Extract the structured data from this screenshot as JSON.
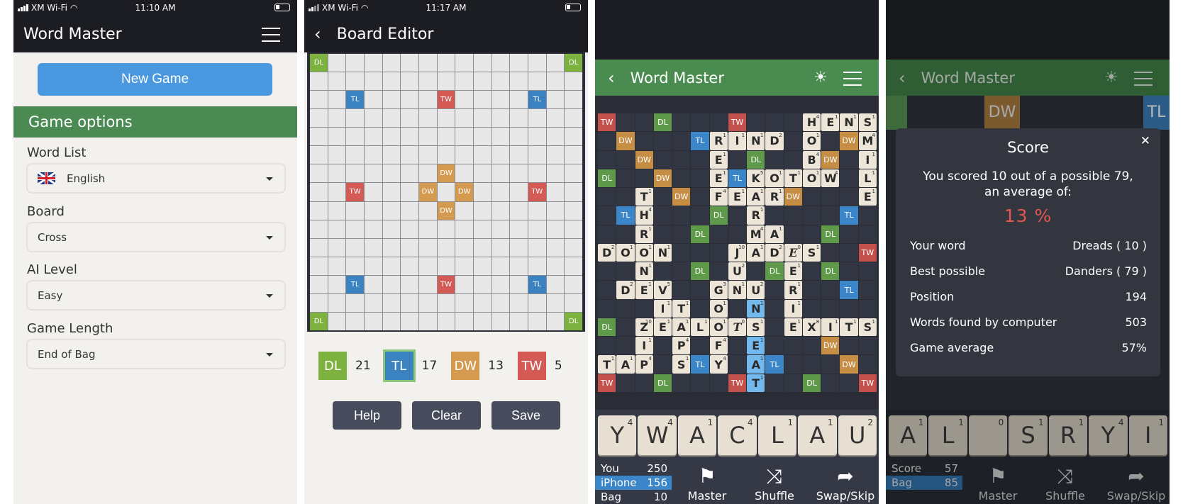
{
  "screen1": {
    "status": {
      "carrier": "XM Wi-Fi",
      "time": "11:10 AM"
    },
    "title": "Word Master",
    "new_game_label": "New Game",
    "options_header": "Game options",
    "options": [
      {
        "label": "Word List",
        "value": "English",
        "flag": "uk-flag"
      },
      {
        "label": "Board",
        "value": "Cross"
      },
      {
        "label": "AI Level",
        "value": "Easy"
      },
      {
        "label": "Game Length",
        "value": "End of Bag"
      }
    ]
  },
  "screen2": {
    "status": {
      "carrier": "XM Wi-Fi",
      "time": "11:17 AM"
    },
    "title": "Board Editor",
    "board": {
      "size": 15,
      "premiums": [
        {
          "r": 0,
          "c": 0,
          "t": "DL"
        },
        {
          "r": 0,
          "c": 14,
          "t": "DL"
        },
        {
          "r": 2,
          "c": 2,
          "t": "TL"
        },
        {
          "r": 2,
          "c": 7,
          "t": "TW"
        },
        {
          "r": 2,
          "c": 12,
          "t": "TL"
        },
        {
          "r": 6,
          "c": 7,
          "t": "DW"
        },
        {
          "r": 7,
          "c": 2,
          "t": "TW"
        },
        {
          "r": 7,
          "c": 6,
          "t": "DW"
        },
        {
          "r": 7,
          "c": 8,
          "t": "DW"
        },
        {
          "r": 7,
          "c": 12,
          "t": "TW"
        },
        {
          "r": 8,
          "c": 7,
          "t": "DW"
        },
        {
          "r": 12,
          "c": 2,
          "t": "TL"
        },
        {
          "r": 12,
          "c": 7,
          "t": "TW"
        },
        {
          "r": 12,
          "c": 12,
          "t": "TL"
        },
        {
          "r": 14,
          "c": 0,
          "t": "DL"
        },
        {
          "r": 14,
          "c": 14,
          "t": "DL"
        }
      ]
    },
    "legend": [
      {
        "type": "DL",
        "count": "21",
        "selected": false
      },
      {
        "type": "TL",
        "count": "17",
        "selected": true
      },
      {
        "type": "DW",
        "count": "13",
        "selected": false
      },
      {
        "type": "TW",
        "count": "5",
        "selected": false
      }
    ],
    "buttons": {
      "help": "Help",
      "clear": "Clear",
      "save": "Save"
    }
  },
  "screen3": {
    "title": "Word Master",
    "board": {
      "premiums": [
        {
          "r": 0,
          "c": 0,
          "t": "TW"
        },
        {
          "r": 0,
          "c": 3,
          "t": "DL"
        },
        {
          "r": 0,
          "c": 7,
          "t": "TW"
        },
        {
          "r": 1,
          "c": 1,
          "t": "DW"
        },
        {
          "r": 1,
          "c": 5,
          "t": "TL"
        },
        {
          "r": 1,
          "c": 13,
          "t": "DW"
        },
        {
          "r": 2,
          "c": 2,
          "t": "DW"
        },
        {
          "r": 2,
          "c": 8,
          "t": "DL"
        },
        {
          "r": 2,
          "c": 12,
          "t": "DW"
        },
        {
          "r": 3,
          "c": 0,
          "t": "DL"
        },
        {
          "r": 3,
          "c": 3,
          "t": "DW"
        },
        {
          "r": 3,
          "c": 7,
          "t": "TL"
        },
        {
          "r": 4,
          "c": 4,
          "t": "DW"
        },
        {
          "r": 4,
          "c": 10,
          "t": "DW"
        },
        {
          "r": 5,
          "c": 1,
          "t": "TL"
        },
        {
          "r": 5,
          "c": 6,
          "t": "DL"
        },
        {
          "r": 5,
          "c": 13,
          "t": "TL"
        },
        {
          "r": 6,
          "c": 5,
          "t": "DL"
        },
        {
          "r": 6,
          "c": 12,
          "t": "DL"
        },
        {
          "r": 7,
          "c": 14,
          "t": "TW"
        },
        {
          "r": 8,
          "c": 5,
          "t": "DL"
        },
        {
          "r": 8,
          "c": 9,
          "t": "DL"
        },
        {
          "r": 8,
          "c": 12,
          "t": "DL"
        },
        {
          "r": 9,
          "c": 13,
          "t": "TL"
        },
        {
          "r": 11,
          "c": 0,
          "t": "DL"
        },
        {
          "r": 12,
          "c": 12,
          "t": "DW"
        },
        {
          "r": 13,
          "c": 5,
          "t": "TL"
        },
        {
          "r": 13,
          "c": 9,
          "t": "TL"
        },
        {
          "r": 13,
          "c": 13,
          "t": "DW"
        },
        {
          "r": 14,
          "c": 0,
          "t": "TW"
        },
        {
          "r": 14,
          "c": 3,
          "t": "DL"
        },
        {
          "r": 14,
          "c": 7,
          "t": "TW"
        },
        {
          "r": 14,
          "c": 11,
          "t": "DL"
        },
        {
          "r": 14,
          "c": 14,
          "t": "TW"
        }
      ],
      "tiles": [
        {
          "r": 0,
          "c": 11,
          "l": "H",
          "p": "4"
        },
        {
          "r": 0,
          "c": 12,
          "l": "E",
          "p": "1"
        },
        {
          "r": 0,
          "c": 13,
          "l": "N",
          "p": "1"
        },
        {
          "r": 0,
          "c": 14,
          "l": "S",
          "p": "1"
        },
        {
          "r": 1,
          "c": 6,
          "l": "R",
          "p": "1"
        },
        {
          "r": 1,
          "c": 7,
          "l": "I",
          "p": "1"
        },
        {
          "r": 1,
          "c": 8,
          "l": "N",
          "p": "1"
        },
        {
          "r": 1,
          "c": 9,
          "l": "D",
          "p": "2"
        },
        {
          "r": 1,
          "c": 11,
          "l": "O",
          "p": "1"
        },
        {
          "r": 1,
          "c": 14,
          "l": "M",
          "p": "4"
        },
        {
          "r": 2,
          "c": 6,
          "l": "E",
          "p": "1"
        },
        {
          "r": 2,
          "c": 11,
          "l": "B",
          "p": "4"
        },
        {
          "r": 2,
          "c": 14,
          "l": "I",
          "p": "1"
        },
        {
          "r": 3,
          "c": 6,
          "l": "E",
          "p": "1"
        },
        {
          "r": 3,
          "c": 8,
          "l": "K",
          "p": "5"
        },
        {
          "r": 3,
          "c": 9,
          "l": "O",
          "p": "1"
        },
        {
          "r": 3,
          "c": 10,
          "l": "T",
          "p": "1"
        },
        {
          "r": 3,
          "c": 11,
          "l": "O",
          "p": "1"
        },
        {
          "r": 3,
          "c": 12,
          "l": "W",
          "p": "4"
        },
        {
          "r": 3,
          "c": 14,
          "l": "L",
          "p": "1"
        },
        {
          "r": 4,
          "c": 2,
          "l": "T",
          "p": "1"
        },
        {
          "r": 4,
          "c": 6,
          "l": "F",
          "p": "4"
        },
        {
          "r": 4,
          "c": 7,
          "l": "E",
          "p": "1"
        },
        {
          "r": 4,
          "c": 8,
          "l": "A",
          "p": "1"
        },
        {
          "r": 4,
          "c": 9,
          "l": "R",
          "p": "1"
        },
        {
          "r": 4,
          "c": 14,
          "l": "E",
          "p": "1"
        },
        {
          "r": 5,
          "c": 2,
          "l": "H",
          "p": "4"
        },
        {
          "r": 5,
          "c": 8,
          "l": "R",
          "p": "1"
        },
        {
          "r": 6,
          "c": 2,
          "l": "R",
          "p": "1"
        },
        {
          "r": 6,
          "c": 8,
          "l": "M",
          "p": "4"
        },
        {
          "r": 6,
          "c": 9,
          "l": "A",
          "p": "1"
        },
        {
          "r": 7,
          "c": 0,
          "l": "D",
          "p": "2"
        },
        {
          "r": 7,
          "c": 1,
          "l": "O",
          "p": "1"
        },
        {
          "r": 7,
          "c": 2,
          "l": "O",
          "p": "1"
        },
        {
          "r": 7,
          "c": 3,
          "l": "N",
          "p": "1"
        },
        {
          "r": 7,
          "c": 7,
          "l": "J",
          "p": "10"
        },
        {
          "r": 7,
          "c": 8,
          "l": "A",
          "p": "1"
        },
        {
          "r": 7,
          "c": 9,
          "l": "D",
          "p": "2"
        },
        {
          "r": 7,
          "c": 10,
          "l": "E",
          "p": "0",
          "blank": true
        },
        {
          "r": 7,
          "c": 11,
          "l": "S",
          "p": "1"
        },
        {
          "r": 8,
          "c": 2,
          "l": "N",
          "p": "1"
        },
        {
          "r": 8,
          "c": 7,
          "l": "U",
          "p": "2"
        },
        {
          "r": 8,
          "c": 10,
          "l": "E",
          "p": "1"
        },
        {
          "r": 9,
          "c": 1,
          "l": "D",
          "p": "2"
        },
        {
          "r": 9,
          "c": 2,
          "l": "E",
          "p": "1"
        },
        {
          "r": 9,
          "c": 3,
          "l": "V",
          "p": "5"
        },
        {
          "r": 9,
          "c": 6,
          "l": "G",
          "p": "3"
        },
        {
          "r": 9,
          "c": 7,
          "l": "N",
          "p": "1"
        },
        {
          "r": 9,
          "c": 8,
          "l": "U",
          "p": "2"
        },
        {
          "r": 9,
          "c": 10,
          "l": "R",
          "p": "1"
        },
        {
          "r": 10,
          "c": 3,
          "l": "I",
          "p": "1"
        },
        {
          "r": 10,
          "c": 4,
          "l": "T",
          "p": "1"
        },
        {
          "r": 10,
          "c": 6,
          "l": "O",
          "p": "1"
        },
        {
          "r": 10,
          "c": 8,
          "l": "N",
          "p": "1",
          "new": true
        },
        {
          "r": 10,
          "c": 10,
          "l": "I",
          "p": "1"
        },
        {
          "r": 11,
          "c": 2,
          "l": "Z",
          "p": "10"
        },
        {
          "r": 11,
          "c": 3,
          "l": "E",
          "p": "1"
        },
        {
          "r": 11,
          "c": 4,
          "l": "A",
          "p": "1"
        },
        {
          "r": 11,
          "c": 5,
          "l": "L",
          "p": "1"
        },
        {
          "r": 11,
          "c": 6,
          "l": "O",
          "p": "1"
        },
        {
          "r": 11,
          "c": 7,
          "l": "T",
          "p": "0",
          "blank": true
        },
        {
          "r": 11,
          "c": 8,
          "l": "S",
          "p": "1"
        },
        {
          "r": 11,
          "c": 10,
          "l": "E",
          "p": "1"
        },
        {
          "r": 11,
          "c": 11,
          "l": "X",
          "p": "8"
        },
        {
          "r": 11,
          "c": 12,
          "l": "I",
          "p": "1"
        },
        {
          "r": 11,
          "c": 13,
          "l": "T",
          "p": "1"
        },
        {
          "r": 11,
          "c": 14,
          "l": "S",
          "p": "1"
        },
        {
          "r": 12,
          "c": 2,
          "l": "I",
          "p": "1"
        },
        {
          "r": 12,
          "c": 4,
          "l": "P",
          "p": "4"
        },
        {
          "r": 12,
          "c": 6,
          "l": "F",
          "p": "4"
        },
        {
          "r": 12,
          "c": 8,
          "l": "E",
          "p": "1",
          "new": true
        },
        {
          "r": 13,
          "c": 0,
          "l": "T",
          "p": "1"
        },
        {
          "r": 13,
          "c": 1,
          "l": "A",
          "p": "1"
        },
        {
          "r": 13,
          "c": 2,
          "l": "P",
          "p": "4"
        },
        {
          "r": 13,
          "c": 4,
          "l": "S",
          "p": "1"
        },
        {
          "r": 13,
          "c": 6,
          "l": "Y",
          "p": "4"
        },
        {
          "r": 13,
          "c": 8,
          "l": "A",
          "p": "1",
          "new": true
        },
        {
          "r": 14,
          "c": 8,
          "l": "T",
          "p": "1",
          "new": true
        }
      ]
    },
    "rack": [
      {
        "l": "Y",
        "p": "4"
      },
      {
        "l": "W",
        "p": "4"
      },
      {
        "l": "A",
        "p": "1"
      },
      {
        "l": "C",
        "p": "4"
      },
      {
        "l": "L",
        "p": "1"
      },
      {
        "l": "A",
        "p": "1"
      },
      {
        "l": "U",
        "p": "2"
      }
    ],
    "scores": [
      {
        "name": "You",
        "value": "250",
        "highlight": false
      },
      {
        "name": "iPhone",
        "value": "156",
        "highlight": true
      },
      {
        "name": "Bag",
        "value": "10",
        "highlight": false
      }
    ],
    "actions": {
      "master": "Master",
      "shuffle": "Shuffle",
      "swap": "Swap/Skip"
    }
  },
  "screen4": {
    "title": "Word Master",
    "modal": {
      "title": "Score",
      "message_line1": "You scored 10 out of a possible 79,",
      "message_line2": "an average of:",
      "percent": "13  %",
      "stats": [
        {
          "label": "Your word",
          "value": "Dreads ( 10 )"
        },
        {
          "label": "Best possible",
          "value": "Danders ( 79 )"
        },
        {
          "label": "Position",
          "value": "194"
        },
        {
          "label": "Words found by computer",
          "value": "503"
        },
        {
          "label": "Game average",
          "value": "57%"
        }
      ]
    },
    "rack": [
      {
        "l": "A",
        "p": "1"
      },
      {
        "l": "L",
        "p": "1"
      },
      {
        "l": "",
        "p": "0"
      },
      {
        "l": "S",
        "p": "1"
      },
      {
        "l": "R",
        "p": "1"
      },
      {
        "l": "Y",
        "p": "4"
      },
      {
        "l": "I",
        "p": "1"
      }
    ],
    "scores": [
      {
        "name": "Score",
        "value": "57",
        "highlight": false
      },
      {
        "name": "Bag",
        "value": "85",
        "highlight": true
      }
    ],
    "actions": {
      "master": "Master",
      "shuffle": "Shuffle",
      "swap": "Swap/Skip"
    }
  },
  "colors": {
    "DL": "#7db240",
    "TL": "#3b83c0",
    "DW": "#d49a50",
    "TW": "#d35a55",
    "accent_blue": "#4a98df",
    "green_header": "#4b8b53"
  }
}
